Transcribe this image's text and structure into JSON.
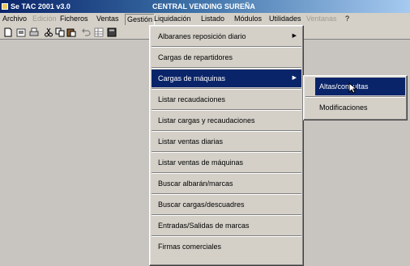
{
  "window": {
    "app_title": "Se TAC 2001 v3.0",
    "doc_title": "CENTRAL VENDING SUREÑA"
  },
  "menubar": {
    "items": [
      {
        "label": "Archivo",
        "disabled": false
      },
      {
        "label": "Edición",
        "disabled": true
      },
      {
        "label": "Ficheros",
        "disabled": false
      },
      {
        "label": "Ventas",
        "disabled": false
      },
      {
        "label": "Gestión",
        "disabled": false,
        "open": true
      },
      {
        "label": "Liquidación",
        "disabled": false
      },
      {
        "label": "Listado",
        "disabled": false
      },
      {
        "label": "Módulos",
        "disabled": false
      },
      {
        "label": "Utilidades",
        "disabled": false
      },
      {
        "label": "Ventanas",
        "disabled": true
      },
      {
        "label": "?",
        "disabled": false
      }
    ]
  },
  "toolbar": {
    "icons": [
      "new-icon",
      "open-icon",
      "print-icon",
      "cut-icon",
      "copy-icon",
      "paste-icon",
      "undo-icon",
      "grid-icon",
      "calc-icon"
    ]
  },
  "gestion_menu": {
    "items": [
      {
        "label": "Albaranes reposición diario",
        "has_submenu": true
      },
      {
        "label": "Cargas de repartidores",
        "has_submenu": false
      },
      {
        "label": "Cargas de máquinas",
        "has_submenu": true,
        "selected": true
      },
      {
        "label": "Listar recaudaciones",
        "has_submenu": false
      },
      {
        "label": "Listar cargas y recaudaciones",
        "has_submenu": false
      },
      {
        "label": "Listar ventas diarias",
        "has_submenu": false
      },
      {
        "label": "Listar ventas de máquinas",
        "has_submenu": false
      },
      {
        "label": "Buscar albarán/marcas",
        "has_submenu": false
      },
      {
        "label": "Buscar cargas/descuadres",
        "has_submenu": false
      },
      {
        "label": "Entradas/Salidas de marcas",
        "has_submenu": false
      },
      {
        "label": "Firmas comerciales",
        "has_submenu": false
      }
    ]
  },
  "submenu": {
    "items": [
      {
        "label": "Altas/consultas",
        "selected": true
      },
      {
        "label": "Modificaciones",
        "selected": false
      }
    ]
  },
  "colors": {
    "highlight": "#0a246a",
    "menu_face": "#d4d0c8",
    "client_bg": "#c8c5c1"
  }
}
